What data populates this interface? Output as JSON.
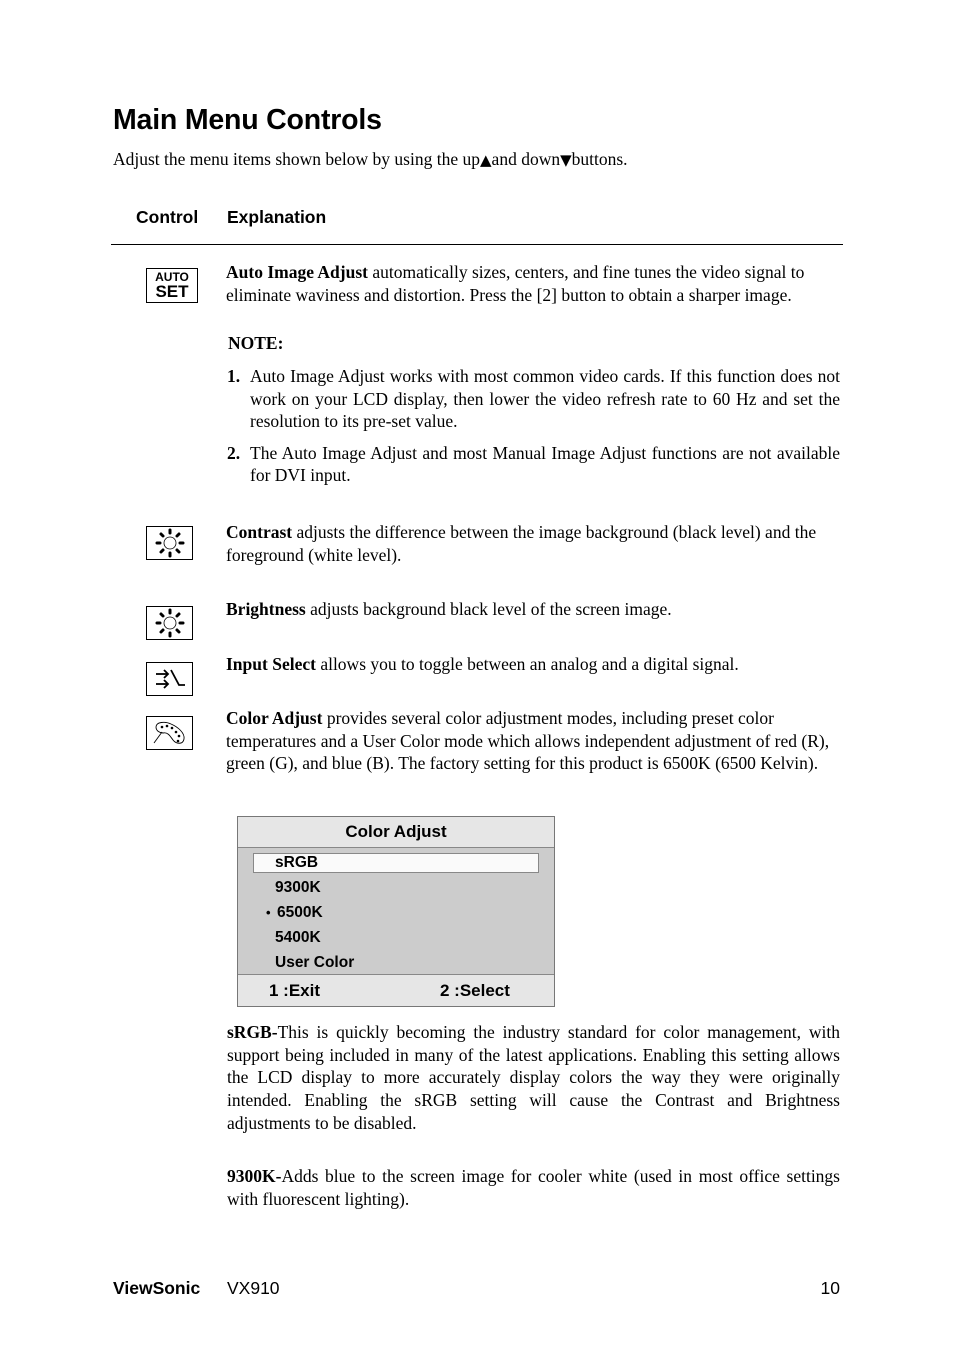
{
  "title": "Main Menu Controls",
  "intro": {
    "before": "Adjust the menu items shown below by using the up",
    "up_symbol": "▲",
    "middle": "and down",
    "down_symbol": "▼",
    "after": "buttons."
  },
  "table_header": {
    "control": "Control",
    "explanation": "Explanation"
  },
  "controls": {
    "auto_image_adjust": {
      "icon": "auto-set-icon",
      "icon_line1": "AUTO",
      "icon_line2": "SET",
      "name": "Auto Image Adjust",
      "text": " automatically sizes, centers, and fine tunes the video signal to eliminate waviness and distortion. Press the [2] button to obtain a sharper image.",
      "note_label": "NOTE:",
      "notes": [
        {
          "num": "1.",
          "text": "Auto Image Adjust works with most common video cards. If this function does not work on your LCD display, then lower the video refresh rate to 60 Hz and set the resolution to its pre-set value."
        },
        {
          "num": "2.",
          "text": "The Auto Image Adjust and most Manual Image Adjust functions are not available for DVI input."
        }
      ]
    },
    "contrast": {
      "icon": "contrast-sun-icon",
      "name": "Contrast",
      "text": " adjusts the difference between the image background  (black level) and the foreground (white level)."
    },
    "brightness": {
      "icon": "brightness-sun-icon",
      "name": "Brightness",
      "text": " adjusts background black level of the screen image."
    },
    "input_select": {
      "icon": "input-select-icon",
      "name": "Input Select",
      "text": " allows you to toggle between an analog and a digital signal."
    },
    "color_adjust": {
      "icon": "color-palette-icon",
      "name": "Color Adjust",
      "text": " provides several color adjustment modes, including preset color temperatures and a User Color mode which allows independent adjustment of red (R), green (G), and blue (B). The factory setting for this product is 6500K (6500 Kelvin)."
    }
  },
  "osd": {
    "title": "Color Adjust",
    "items": [
      "sRGB",
      "9300K",
      "6500K",
      "5400K",
      "User Color"
    ],
    "highlighted": "sRGB",
    "current_marker": "•",
    "current": "6500K",
    "exit_label": "1 :Exit",
    "select_label": "2 :Select"
  },
  "descriptions": {
    "srgb": {
      "term": "sRGB-",
      "text": "This is quickly becoming the industry standard for color management, with support being included in many of the latest applications. Enabling this setting allows the LCD display to more accurately display colors the way they were originally intended. Enabling the sRGB setting will cause the Contrast and Brightness adjustments to be disabled."
    },
    "k9300": {
      "term": "9300K-",
      "text": "Adds blue to the screen image for cooler white (used in most office settings with fluorescent lighting)."
    }
  },
  "footer": {
    "brand": "ViewSonic",
    "model": "VX910",
    "page": "10"
  }
}
